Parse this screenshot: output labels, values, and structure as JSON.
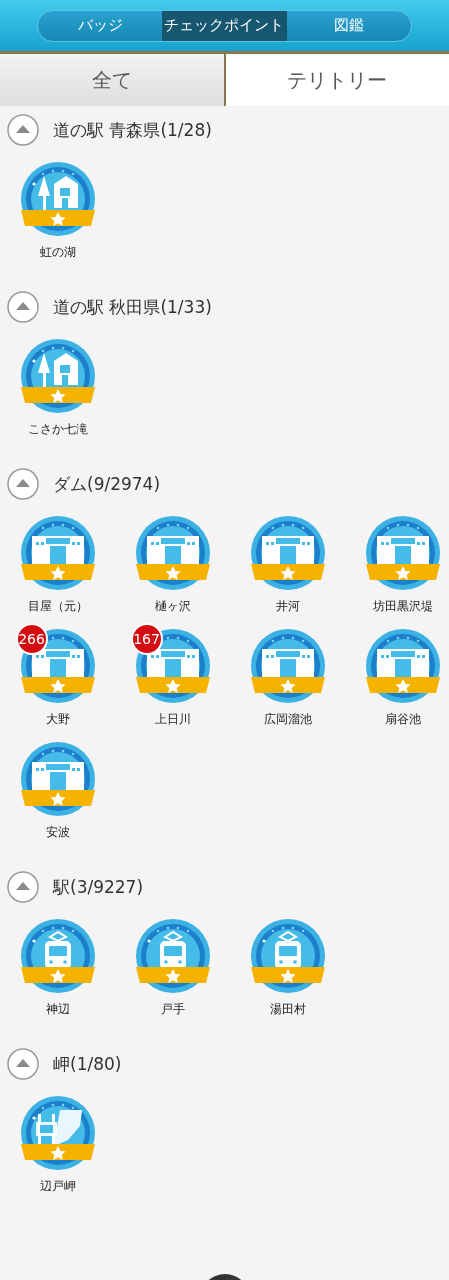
{
  "segments": [
    {
      "label": "バッジ",
      "selected": false
    },
    {
      "label": "チェックポイント",
      "selected": true
    },
    {
      "label": "図鑑",
      "selected": false
    }
  ],
  "tabs": [
    {
      "label": "全て",
      "selected": false
    },
    {
      "label": "テリトリー",
      "selected": true
    }
  ],
  "sections": [
    {
      "title": "道の駅 青森県(1/28)",
      "expanded": true,
      "badges": [
        {
          "label": "虹の湖",
          "kind": "roadside"
        }
      ]
    },
    {
      "title": "道の駅 秋田県(1/33)",
      "expanded": true,
      "badges": [
        {
          "label": "こさか七滝",
          "kind": "roadside"
        }
      ]
    },
    {
      "title": "ダム(9/2974)",
      "expanded": true,
      "badges": [
        {
          "label": "目屋（元）",
          "kind": "dam"
        },
        {
          "label": "樋ヶ沢",
          "kind": "dam"
        },
        {
          "label": "井河",
          "kind": "dam"
        },
        {
          "label": "坊田黒沢堤",
          "kind": "dam"
        },
        {
          "label": "大野",
          "kind": "dam",
          "count": "266"
        },
        {
          "label": "上日川",
          "kind": "dam",
          "count": "167"
        },
        {
          "label": "広岡溜池",
          "kind": "dam"
        },
        {
          "label": "扇谷池",
          "kind": "dam"
        },
        {
          "label": "安波",
          "kind": "dam"
        }
      ]
    },
    {
      "title": "駅(3/9227)",
      "expanded": true,
      "badges": [
        {
          "label": "神辺",
          "kind": "train"
        },
        {
          "label": "戸手",
          "kind": "train"
        },
        {
          "label": "湯田村",
          "kind": "train"
        }
      ]
    },
    {
      "title": "岬(1/80)",
      "expanded": true,
      "badges": [
        {
          "label": "辺戸岬",
          "kind": "cape"
        }
      ]
    }
  ]
}
